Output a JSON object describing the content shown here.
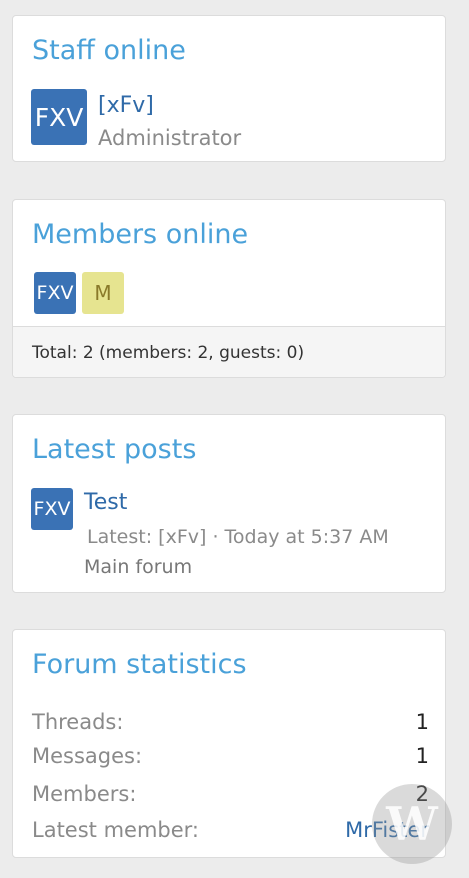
{
  "staff_online": {
    "title": "Staff online",
    "member": {
      "avatar_text": "FXV",
      "name": "[xFv]",
      "role": "Administrator"
    }
  },
  "members_online": {
    "title": "Members online",
    "avatars": [
      {
        "text": "FXV",
        "color": "#3a72b5"
      },
      {
        "text": "M",
        "color": "#e6e490"
      }
    ],
    "total": "Total: 2 (members: 2, guests: 0)"
  },
  "latest_posts": {
    "title": "Latest posts",
    "post": {
      "avatar_text": "FXV",
      "title": "Test",
      "meta": "Latest: [xFv]  · Today at 5:37 AM",
      "forum": "Main forum"
    }
  },
  "forum_statistics": {
    "title": "Forum statistics",
    "rows": [
      {
        "label": "Threads:",
        "value": "1"
      },
      {
        "label": "Messages:",
        "value": "1"
      },
      {
        "label": "Members:",
        "value": "2"
      },
      {
        "label": "Latest member:",
        "value": "MrFister"
      }
    ]
  },
  "watermark": {
    "text": "W"
  },
  "colors": {
    "accent": "#4aa1d9",
    "link": "#2f6aa8",
    "avatar_blue": "#3a72b5",
    "avatar_yellow": "#e6e490"
  }
}
